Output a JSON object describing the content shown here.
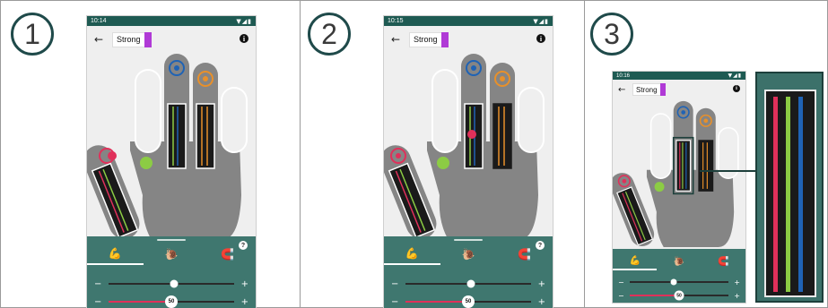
{
  "steps": [
    {
      "number": "1",
      "time": "10:14",
      "profile": "Strong",
      "slider_value": "50"
    },
    {
      "number": "2",
      "time": "10:15",
      "profile": "Strong",
      "slider_value": "50"
    },
    {
      "number": "3",
      "time": "10:16",
      "profile": "Strong",
      "slider_value": "50"
    }
  ],
  "status_icons": "▼◢▮",
  "app_bar": {
    "back_icon": "←",
    "info_icon": "i"
  },
  "bottom_panel": {
    "tabs": [
      {
        "name": "strength-tab",
        "icon": "arm-flex-icon",
        "glyph": "💪"
      },
      {
        "name": "snail-tab",
        "icon": "snail-icon",
        "glyph": "🐌"
      },
      {
        "name": "magnet-tab",
        "icon": "magnet-icon",
        "glyph": "🧲"
      }
    ],
    "help": "?",
    "minus": "−",
    "plus": "+"
  },
  "colors": {
    "teal_dark": "#1e5a52",
    "teal_panel": "#3f776f",
    "hand_gray": "#858585",
    "finger_outline": "#ffffff",
    "pink": "#e0305a",
    "green": "#8ccc44",
    "blue": "#1f63b5",
    "orange": "#e8902a",
    "profile_purple": "#b03ad6"
  }
}
